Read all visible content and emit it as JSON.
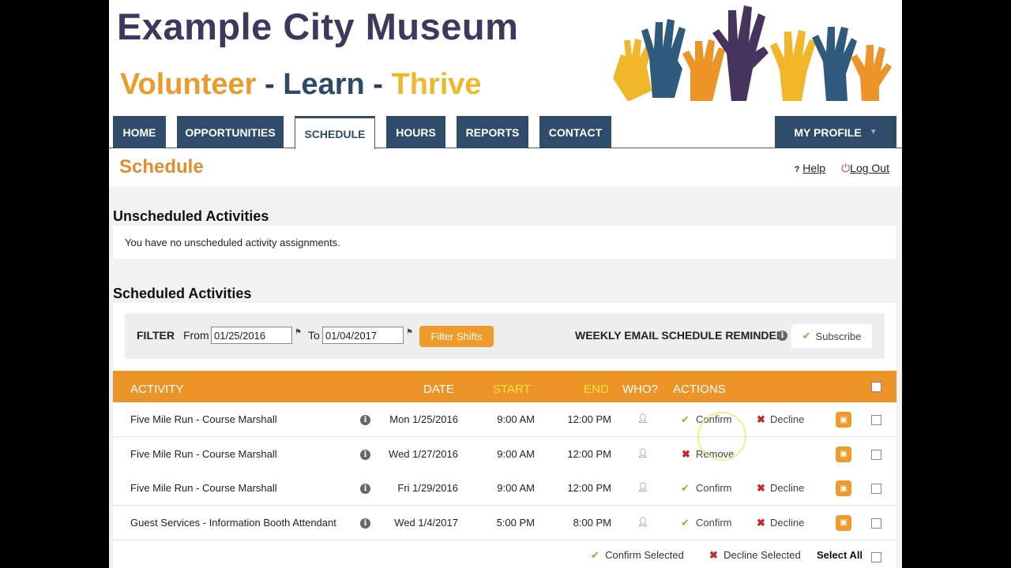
{
  "site": {
    "title": "Example City Museum",
    "tagline": {
      "w1": "Volunteer",
      "sep": "-",
      "w2": "Learn",
      "w3": "Thrive"
    }
  },
  "nav": {
    "tabs": [
      "HOME",
      "OPPORTUNITIES",
      "SCHEDULE",
      "HOURS",
      "REPORTS",
      "CONTACT"
    ],
    "active": "SCHEDULE",
    "profile": "MY PROFILE"
  },
  "page": {
    "title": "Schedule",
    "help": "Help",
    "logout": "Log Out"
  },
  "unscheduled": {
    "heading": "Unscheduled Activities",
    "message": "You have no unscheduled activity assignments."
  },
  "scheduled": {
    "heading": "Scheduled Activities"
  },
  "filter": {
    "label": "FILTER",
    "from_label": "From",
    "from": "01/25/2016",
    "to_label": "To",
    "to": "01/04/2017",
    "button": "Filter Shifts",
    "reminder": "WEEKLY EMAIL SCHEDULE REMINDER",
    "subscribe": "Subscribe"
  },
  "table": {
    "headers": {
      "activity": "ACTIVITY",
      "date": "DATE",
      "start": "START",
      "end": "END",
      "who": "WHO?",
      "actions": "ACTIONS"
    },
    "rows": [
      {
        "activity": "Five Mile Run - Course Marshall",
        "date": "Mon 1/25/2016",
        "start": "9:00 AM",
        "end": "12:00 PM",
        "a1": "Confirm",
        "a2": "Decline"
      },
      {
        "activity": "Five Mile Run - Course Marshall",
        "date": "Wed 1/27/2016",
        "start": "9:00 AM",
        "end": "12:00 PM",
        "a1": "Remove",
        "a2": ""
      },
      {
        "activity": "Five Mile Run - Course Marshall",
        "date": "Fri 1/29/2016",
        "start": "9:00 AM",
        "end": "12:00 PM",
        "a1": "Confirm",
        "a2": "Decline"
      },
      {
        "activity": "Guest Services - Information Booth Attendant",
        "date": "Wed 1/4/2017",
        "start": "5:00 PM",
        "end": "8:00 PM",
        "a1": "Confirm",
        "a2": "Decline"
      }
    ]
  },
  "footer": {
    "confirm_selected": "Confirm Selected",
    "decline_selected": "Decline Selected",
    "select_all": "Select All"
  },
  "colors": {
    "navy": "#2f4d6b",
    "orange": "#ec9428",
    "title_orange": "#e38c2c"
  }
}
